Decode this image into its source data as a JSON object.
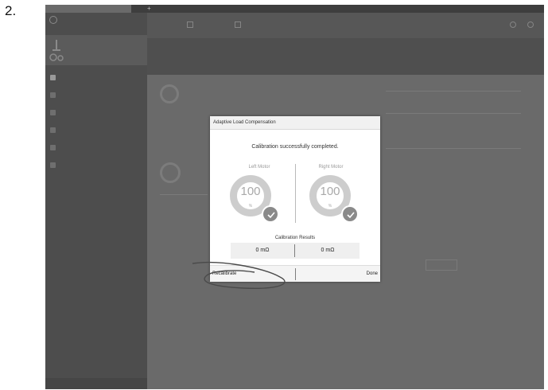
{
  "step_number": "2.",
  "dialog": {
    "title": "Adaptive Load Compensation",
    "message": "Calibration successfully completed.",
    "left_motor": {
      "label": "Left Motor",
      "value": "100",
      "unit": "%",
      "result": "0 mΩ"
    },
    "right_motor": {
      "label": "Right Motor",
      "value": "100",
      "unit": "%",
      "result": "0 mΩ"
    },
    "results_title": "Calibration Results",
    "recalibrate_label": "Recalibrate",
    "done_label": "Done"
  },
  "colors": {
    "dialog_bg": "#ffffff",
    "check_badge": "#8a8a8a",
    "gauge_ring": "#cdcdcd",
    "overlay": "#5a5a5a"
  },
  "icons": [
    "check-icon",
    "wheelchair-icon",
    "settings-icon"
  ]
}
